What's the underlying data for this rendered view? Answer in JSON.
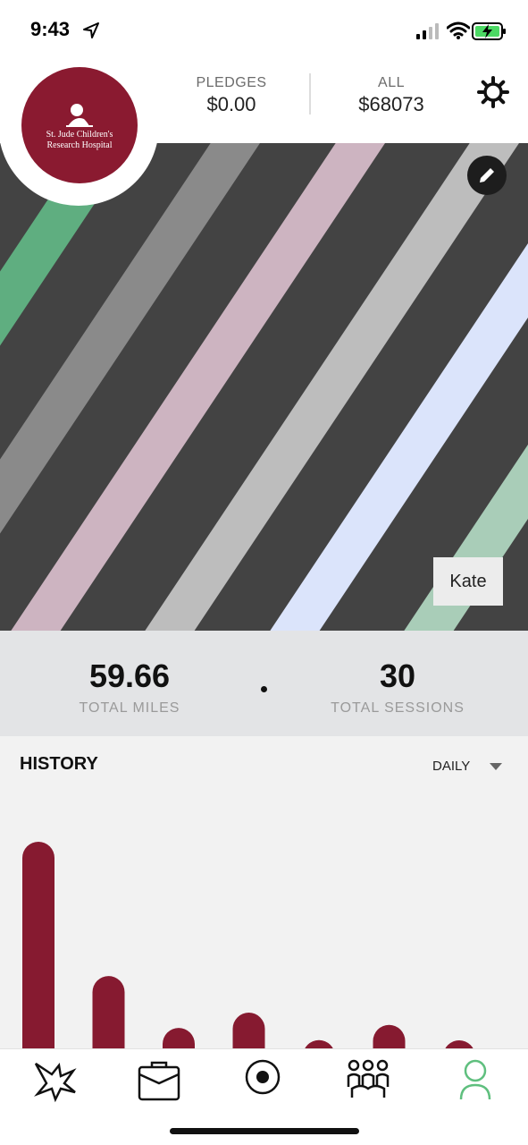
{
  "status_bar": {
    "time": "9:43",
    "icons": [
      "location-arrow-icon",
      "signal-icon",
      "wifi-icon",
      "battery-charging-icon"
    ],
    "battery_color": "#4cd964"
  },
  "header": {
    "logo": {
      "line1": "St. Jude Children's",
      "line2": "Research Hospital",
      "color": "#8a1a30"
    },
    "pledges": {
      "label": "PLEDGES",
      "value": "$0.00"
    },
    "all": {
      "label": "ALL",
      "value": "$68073"
    },
    "settings_icon": "gear-icon"
  },
  "cover": {
    "background": "#434343",
    "stripe_colors": [
      "#5fae80",
      "#8a8a8a",
      "#cdb4c1",
      "#bdbdbd",
      "#dbe4fb",
      "#a9cdb8"
    ],
    "edit_icon": "pencil-icon",
    "name": "Kate"
  },
  "totals": {
    "miles": {
      "value": "59.66",
      "label": "TOTAL MILES"
    },
    "sessions": {
      "value": "30",
      "label": "TOTAL SESSIONS"
    }
  },
  "history": {
    "title": "HISTORY",
    "period": "DAILY",
    "bar_color": "#861a30"
  },
  "chart_data": {
    "type": "bar",
    "values": [
      6.8,
      2.4,
      0.7,
      1.2,
      0.3,
      0.8,
      0.1
    ]
  },
  "tabbar": {
    "items": [
      {
        "icon": "starburst-icon"
      },
      {
        "icon": "briefcase-icon"
      },
      {
        "icon": "record-icon"
      },
      {
        "icon": "team-icon"
      },
      {
        "icon": "profile-icon",
        "active": true
      }
    ],
    "active_color": "#5fbf7e"
  }
}
